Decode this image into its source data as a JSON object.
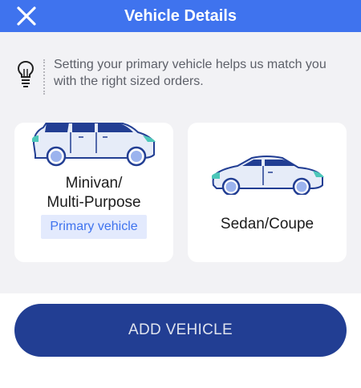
{
  "header": {
    "title": "Vehicle Details"
  },
  "tip": {
    "text": "Setting your primary vehicle helps us match you with the right sized orders."
  },
  "vehicles": [
    {
      "line1": "Minivan/",
      "line2": "Multi-Purpose",
      "badge": "Primary vehicle"
    },
    {
      "label": "Sedan/Coupe"
    }
  ],
  "footer": {
    "add_button": "ADD VEHICLE"
  },
  "colors": {
    "header": "#3f73ee",
    "button": "#223e93",
    "badge_bg": "#e3eafd",
    "car_teal": "#4cc7b9"
  }
}
